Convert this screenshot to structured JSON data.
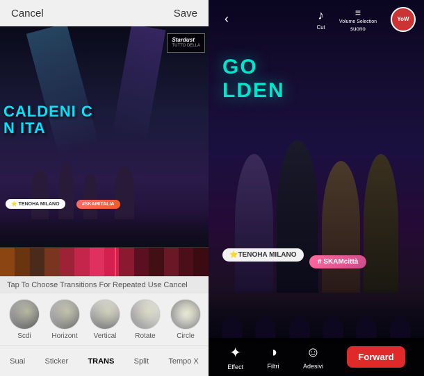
{
  "left": {
    "header": {
      "cancel_label": "Cancel",
      "save_label": "Save"
    },
    "video": {
      "golden_text_line1": "CALDENI C",
      "golden_text_line2": "N ITA",
      "sticker_milano": "⭐ TENOHA MILANO",
      "sticker_skam": "#SKAMITALIA",
      "banner_logo": "Stardust",
      "banner_text": "TUTTO\nDELLA"
    },
    "transition_msg": "Tap To Choose Transitions For Repeated Use Cancel",
    "transitions": [
      {
        "label": "Scdi"
      },
      {
        "label": "Horizont"
      },
      {
        "label": "Vertical"
      },
      {
        "label": "Rotate"
      },
      {
        "label": "Circle"
      }
    ],
    "toolbar": {
      "items": [
        "Suai",
        "Sticker",
        "TRANS",
        "Split",
        "Tempo X"
      ]
    }
  },
  "right": {
    "top_bar": {
      "back_label": "‹",
      "cut_label": "Cut",
      "volume_label": "Volume Selection",
      "suono_label": "suono",
      "avatar_text": "YoW"
    },
    "video": {
      "golden_text": "GO\nLDEN",
      "sticker_milano": "⭐TENOHA MILANO",
      "sticker_skam": "# SKAMcittà"
    },
    "bottom_bar": {
      "effect_label": "Effect",
      "filtri_label": "Filtri",
      "adesivi_label": "Adesivi",
      "forward_label": "Forward"
    }
  }
}
